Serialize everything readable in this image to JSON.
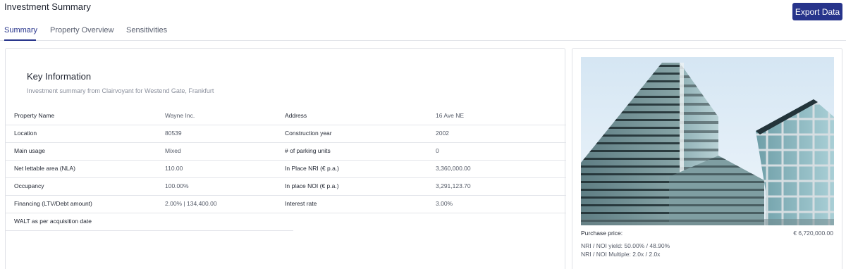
{
  "header": {
    "title": "Investment Summary",
    "export_label": "Export Data"
  },
  "tabs": [
    {
      "label": "Summary",
      "active": true
    },
    {
      "label": "Property Overview",
      "active": false
    },
    {
      "label": "Sensitivities",
      "active": false
    }
  ],
  "key_info": {
    "title": "Key Information",
    "subtitle": "Investment summary from Clairvoyant for Westend Gate, Frankfurt",
    "rows": [
      {
        "label1": "Property Name",
        "value1": "Wayne Inc.",
        "label2": "Address",
        "value2": "16 Ave NE"
      },
      {
        "label1": "Location",
        "value1": "80539",
        "label2": "Construction year",
        "value2": "2002"
      },
      {
        "label1": "Main usage",
        "value1": "Mixed",
        "label2": "# of parking units",
        "value2": "0"
      },
      {
        "label1": "Net lettable area (NLA)",
        "value1": "110.00",
        "label2": "In Place NRI (€ p.a.)",
        "value2": "3,360,000.00"
      },
      {
        "label1": "Occupancy",
        "value1": "100.00%",
        "label2": "In place NOI (€ p.a.)",
        "value2": "3,291,123.70"
      },
      {
        "label1": "Financing (LTV/Debt amount)",
        "value1": "2.00% | 134,400.00",
        "label2": "Interest rate",
        "value2": "3.00%"
      },
      {
        "label1": "WALT as per acquisition date",
        "value1": "",
        "label2": "",
        "value2": ""
      }
    ]
  },
  "property_card": {
    "purchase_label": "Purchase price:",
    "purchase_value": "€ 6,720,000.00",
    "nri_noi_yield": "NRI / NOI yield: 50.00% / 48.90%",
    "nri_noi_multiple": "NRI / NOI Multiple: 2.0x / 2.0x"
  }
}
